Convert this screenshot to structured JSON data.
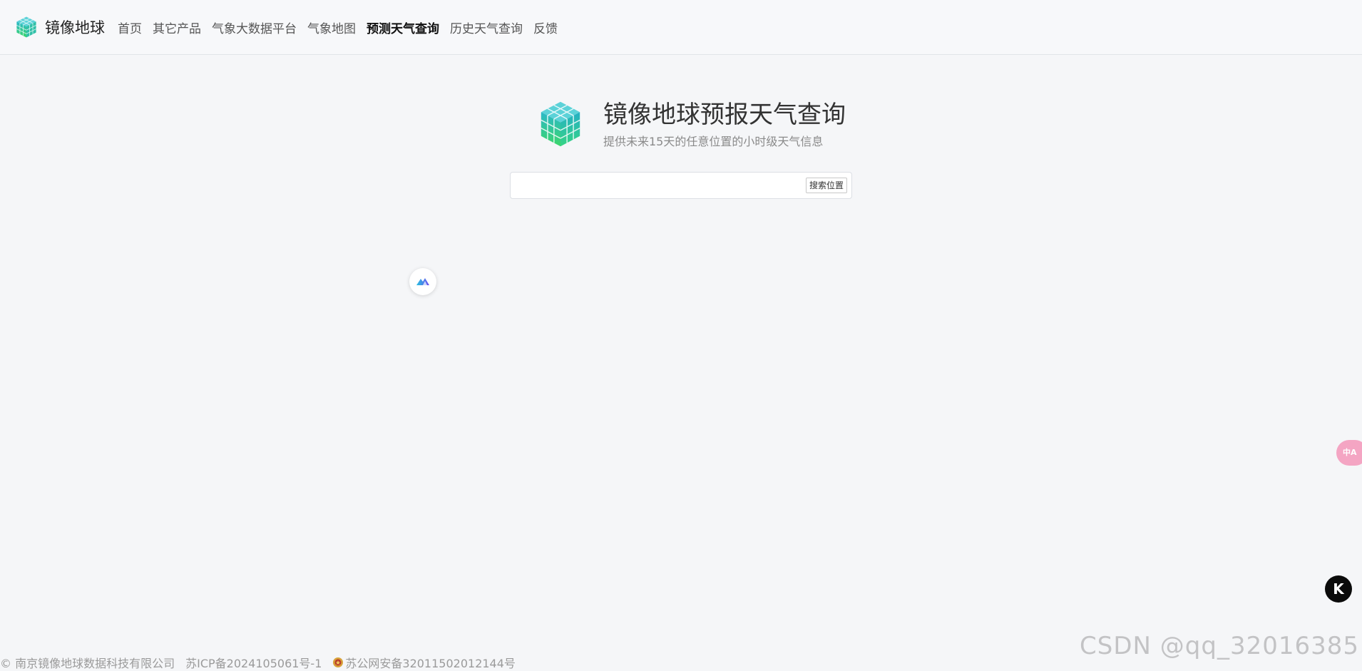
{
  "brand": {
    "name": "镜像地球",
    "logo_icon": "cube-logo-icon"
  },
  "nav": {
    "items": [
      {
        "label": "首页"
      },
      {
        "label": "其它产品"
      },
      {
        "label": "气象大数据平台"
      },
      {
        "label": "气象地图"
      },
      {
        "label": "预测天气查询",
        "active": true
      },
      {
        "label": "历史天气查询"
      },
      {
        "label": "反馈"
      }
    ]
  },
  "hero": {
    "title": "镜像地球预报天气查询",
    "subtitle": "提供未来15天的任意位置的小时级天气信息"
  },
  "search": {
    "value": "",
    "placeholder": "",
    "button_label": "搜索位置"
  },
  "widgets": {
    "ai_icon": "ai-assistant-icon",
    "translate_text": "中A",
    "k_label": "K"
  },
  "footer": {
    "copyright": "© 南京镜像地球数据科技有限公司",
    "icp": "苏ICP备2024105061号-1",
    "police": "苏公网安备32011502012144号"
  },
  "watermark": "CSDN @qq_32016385",
  "colors": {
    "logo_top": "#2bb8c8",
    "logo_bottom": "#3cd66b",
    "translate_badge": "#f4a5c3"
  }
}
